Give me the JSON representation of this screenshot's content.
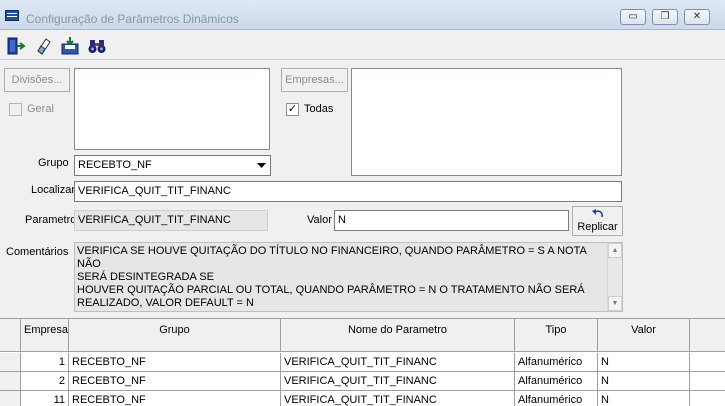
{
  "window": {
    "title": "Configuração de Parâmetros Dinâmicos",
    "controls": {
      "minimize": "▭",
      "restore": "❐",
      "close": "✕"
    }
  },
  "toolbar": {
    "icons": [
      "exit-door-icon",
      "eraser-icon",
      "save-disk-icon",
      "binoculars-icon"
    ]
  },
  "form": {
    "divisoes_button": "Divisões...",
    "geral_label": "Geral",
    "geral_checked": false,
    "empresas_button": "Empresas...",
    "todas_label": "Todas",
    "todas_checked": true,
    "check_mark": "✓",
    "grupo_label": "Grupo",
    "grupo_value": "RECEBTO_NF",
    "localizar_label": "Localizar",
    "localizar_value": "VERIFICA_QUIT_TIT_FINANC",
    "parametro_label": "Parametro",
    "parametro_value": "VERIFICA_QUIT_TIT_FINANC",
    "valor_label": "Valor",
    "valor_value": "N",
    "replicar_label": "Replicar",
    "comentarios_label": "Comentários",
    "comentarios_lines": [
      "VERIFICA SE HOUVE QUITAÇÃO DO TÍTULO NO FINANCEIRO, QUANDO PARÂMETRO = S A NOTA NÃO",
      "SERÁ DESINTEGRADA SE",
      "HOUVER QUITAÇÃO PARCIAL OU TOTAL, QUANDO PARÂMETRO = N O TRATAMENTO NÃO SERÁ",
      "REALIZADO, VALOR DEFAULT = N"
    ]
  },
  "grid": {
    "columns": [
      "Empresa",
      "Grupo",
      "Nome do Parametro",
      "Tipo",
      "Valor"
    ],
    "rows": [
      {
        "empresa": "1",
        "grupo": "RECEBTO_NF",
        "nome": "VERIFICA_QUIT_TIT_FINANC",
        "tipo": "Alfanumérico",
        "valor": "N"
      },
      {
        "empresa": "2",
        "grupo": "RECEBTO_NF",
        "nome": "VERIFICA_QUIT_TIT_FINANC",
        "tipo": "Alfanumérico",
        "valor": "N"
      },
      {
        "empresa": "11",
        "grupo": "RECEBTO_NF",
        "nome": "VERIFICA_QUIT_TIT_FINANC",
        "tipo": "Alfanumérico",
        "valor": "N"
      }
    ]
  }
}
